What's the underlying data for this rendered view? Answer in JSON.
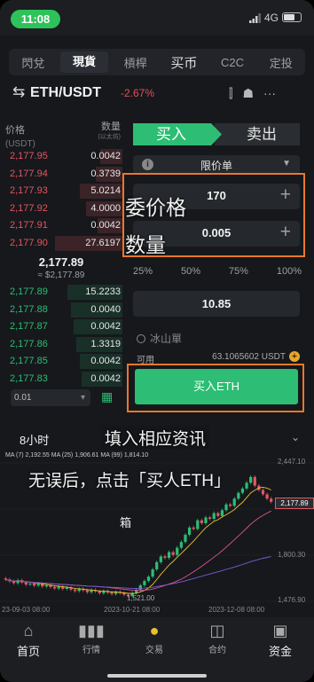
{
  "status": {
    "time": "11:08",
    "network": "4G"
  },
  "tabs": [
    "閃兌",
    "現貨",
    "槓桿",
    "买币",
    "C2C",
    "定投"
  ],
  "active_tab": 1,
  "pair": {
    "name": "ETH/USDT",
    "change": "-2.67%",
    "icon": "swap-arrows-icon"
  },
  "toolbar_icons": [
    "candlestick-icon",
    "bot-icon",
    "more-icon"
  ],
  "orderbook": {
    "price_header": "价格",
    "price_unit": "(USDT)",
    "qty_header": "数量",
    "qty_unit": "(以太坊)",
    "asks": [
      {
        "price": "2,177.95",
        "qty": "0.0042",
        "depth": 0.18
      },
      {
        "price": "2,177.94",
        "qty": "0.3739",
        "depth": 0.22
      },
      {
        "price": "2,177.93",
        "qty": "5.0214",
        "depth": 0.35
      },
      {
        "price": "2,177.92",
        "qty": "4.0000",
        "depth": 0.3
      },
      {
        "price": "2,177.91",
        "qty": "0.0042",
        "depth": 0.2
      },
      {
        "price": "2,177.90",
        "qty": "27.6197",
        "depth": 0.55
      }
    ],
    "mid_price": "2,177.89",
    "mid_sub": "≈ $2,177.89",
    "bids": [
      {
        "price": "2,177.89",
        "qty": "15.2233",
        "depth": 0.45
      },
      {
        "price": "2,177.88",
        "qty": "0.0040",
        "depth": 0.42
      },
      {
        "price": "2,177.87",
        "qty": "0.0042",
        "depth": 0.4
      },
      {
        "price": "2,177.86",
        "qty": "1.3319",
        "depth": 0.38
      },
      {
        "price": "2,177.85",
        "qty": "0.0042",
        "depth": 0.35
      },
      {
        "price": "2,177.83",
        "qty": "0.0042",
        "depth": 0.33
      }
    ],
    "depth_select": "0.01"
  },
  "order": {
    "buy_tab": "买入",
    "sell_tab": "卖出",
    "order_type": "限价单",
    "price_value": "170",
    "qty_value": "0.005",
    "percentages": [
      "25%",
      "50%",
      "75%",
      "100%"
    ],
    "amount_value": "10.85",
    "iceberg_label": "冰山單",
    "available_label": "可用",
    "available_value": "63.1065602 USDT",
    "submit_label": "买入ETH"
  },
  "overlay": {
    "price_note": "委价格",
    "qty_note": "数量",
    "line1": "填入相应资讯",
    "line2": "无误后，点击「买人ETH」",
    "chart_note": "箱"
  },
  "chart": {
    "timeframe": "8小时",
    "ma_line": "MA  (7)  2,192.55 MA (25) 1,906.61 MA (99) 1,814.10",
    "y_ticks": [
      "2,447.10",
      "2,177.89",
      "1,800.30",
      "1,476.90"
    ],
    "x_ticks": [
      "23-09-03 08:00",
      "2023-10-21 08:00",
      "2023-12-08 08:00"
    ],
    "low_label": "1,521.00",
    "last_price": "2,177.89",
    "chart_data": {
      "type": "candlestick",
      "ylim": [
        1476.9,
        2447.1
      ],
      "closes": [
        1640,
        1628,
        1615,
        1635,
        1620,
        1605,
        1612,
        1598,
        1610,
        1592,
        1600,
        1588,
        1578,
        1590,
        1575,
        1584,
        1570,
        1560,
        1575,
        1565,
        1552,
        1568,
        1558,
        1545,
        1560,
        1550,
        1540,
        1555,
        1546,
        1535,
        1525,
        1548,
        1570,
        1600,
        1630,
        1660,
        1710,
        1760,
        1800,
        1790,
        1830,
        1810,
        1860,
        1900,
        1950,
        2000,
        1990,
        2050,
        2030,
        2070,
        2060,
        2100,
        2080,
        2120,
        2160,
        2150,
        2200,
        2240,
        2270,
        2310,
        2350,
        2290,
        2260,
        2230,
        2200,
        2177.89
      ]
    }
  },
  "nav": [
    {
      "label": "首页",
      "icon": "home-icon"
    },
    {
      "label": "行情",
      "icon": "market-icon"
    },
    {
      "label": "交易",
      "icon": "trade-icon"
    },
    {
      "label": "合约",
      "icon": "futures-icon"
    },
    {
      "label": "资金",
      "icon": "wallet-icon"
    }
  ],
  "colors": {
    "up": "#2dbd74",
    "down": "#e45660",
    "accent": "#e9782b"
  }
}
